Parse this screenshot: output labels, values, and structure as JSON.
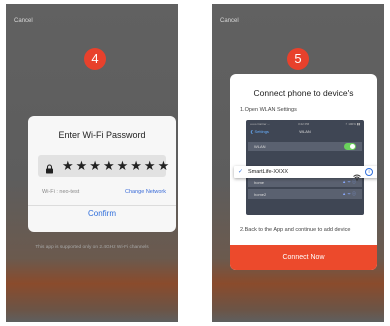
{
  "left_screen": {
    "cancel_label": "Cancel",
    "step_number": "4",
    "dialog": {
      "title": "Enter Wi-Fi Password",
      "password_value": "★★★★★★★★",
      "wifi_label": "Wi-Fi : neo-test",
      "change_network_label": "Change Network",
      "confirm_label": "Confirm"
    },
    "support_note": "This app is supported only on 2.4GHz Wi-Fi channels"
  },
  "right_screen": {
    "cancel_label": "Cancel",
    "step_number": "5",
    "dialog": {
      "title": "Connect phone to device's",
      "step1_label": "1.Open WLAN Settings",
      "step2_label": "2.Back to the App and continue to add device",
      "connect_label": "Connect Now",
      "ios_screenshot": {
        "carrier": "•••oo Carrier ⌵",
        "time": "3:22 PM",
        "battery": "⚡ 100% ▮▮",
        "back_label": "❮ Settings",
        "nav_title": "WLAN",
        "wlan_label": "WLAN",
        "section_label": "CHOOSE A NETWORK...",
        "networks": [
          {
            "name": "home",
            "icons": "▲ ᯤ ⓘ"
          },
          {
            "name": "home2",
            "icons": "▲ ᯤ ⓘ"
          }
        ]
      },
      "highlight_network": {
        "check": "✓",
        "ssid": "SmartLife-XXXX",
        "info": "i"
      }
    }
  },
  "colors": {
    "accent_red": "#e8412c",
    "link_blue": "#2f6edb"
  }
}
